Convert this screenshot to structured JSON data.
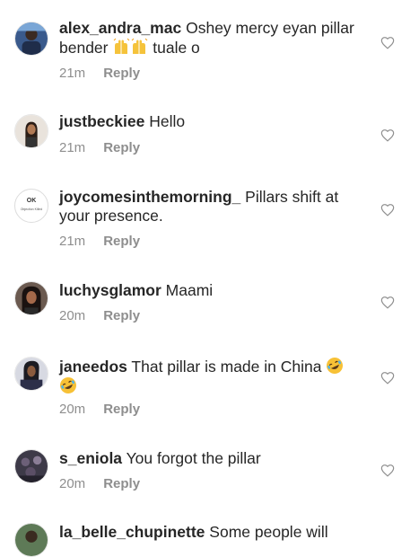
{
  "comments": [
    {
      "username": "alex_andra_mac",
      "text": "Oshey mercy eyan pillar bender",
      "text_after": "tuale o",
      "emoji": [
        "raising-hands-emoji",
        "raising-hands-emoji"
      ],
      "time": "21m",
      "reply": "Reply"
    },
    {
      "username": "justbeckiee",
      "text": "Hello",
      "time": "21m",
      "reply": "Reply"
    },
    {
      "username": "joycomesinthemorning_",
      "text": "Pillars shift at your presence.",
      "time": "21m",
      "reply": "Reply",
      "avatar_text": "OK",
      "avatar_subtext": "Objection Killed"
    },
    {
      "username": "luchysglamor",
      "text": "Maami",
      "time": "20m",
      "reply": "Reply"
    },
    {
      "username": "janeedos",
      "text": "That pillar is made in China",
      "emoji": [
        "rolling-laughing-emoji",
        "rolling-laughing-emoji"
      ],
      "time": "20m",
      "reply": "Reply"
    },
    {
      "username": "s_eniola",
      "text": "You forgot the pillar",
      "time": "20m",
      "reply": "Reply"
    },
    {
      "username": "la_belle_chupinette",
      "text": "Some people will"
    }
  ],
  "icons": {
    "like": "heart-outline-icon"
  },
  "colors": {
    "text": "#262626",
    "meta": "#8e8e8e",
    "heart": "#8e8e8e"
  }
}
